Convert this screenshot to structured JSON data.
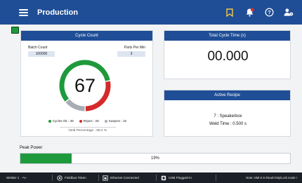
{
  "header": {
    "title": "Production",
    "icons": [
      "menu-icon",
      "bookmark-icon",
      "bell-icon",
      "help-icon",
      "user-settings-icon"
    ],
    "accent_color": "#1f4e96"
  },
  "cycle_count": {
    "header": "Cycle Count",
    "batch_count_label": "Batch Count",
    "batch_count_value": "100000",
    "parts_per_min_label": "Parts Per Min",
    "parts_per_min_value": "3",
    "gauge_value": "67",
    "legend": {
      "ok": "Cycles Ok : 39",
      "reject": "Reject : 28",
      "suspect": "Suspect : 32"
    },
    "gauge_segments": [
      {
        "name": "ok",
        "value": 0.58,
        "color": "#1e9a3c"
      },
      {
        "name": "reject",
        "value": 0.28,
        "color": "#d42a2a"
      },
      {
        "name": "suspect",
        "value": 0.14,
        "color": "#a8adb4"
      }
    ],
    "yield_text": "Yield Percentage : 58.2 %"
  },
  "cycle_time": {
    "header": "Total Cycle Time (s)",
    "value": "00.000"
  },
  "recipe": {
    "header": "Active Recipe",
    "name": "7 : Speakerbox",
    "weld_time": "Weld Time : 0.500 s"
  },
  "peak_power": {
    "label": "Peak Power",
    "percent_text": "19%",
    "fraction": 0.19,
    "fill_color": "#1e9a3c"
  },
  "status_bar": {
    "welder": "Welder 1",
    "fieldbus": "Fieldbus Token",
    "ethernet": "Ethernet Connected",
    "usb": "USB Plugged-In",
    "note": "Note: HMI is in Read-Only/Lock mode !"
  }
}
